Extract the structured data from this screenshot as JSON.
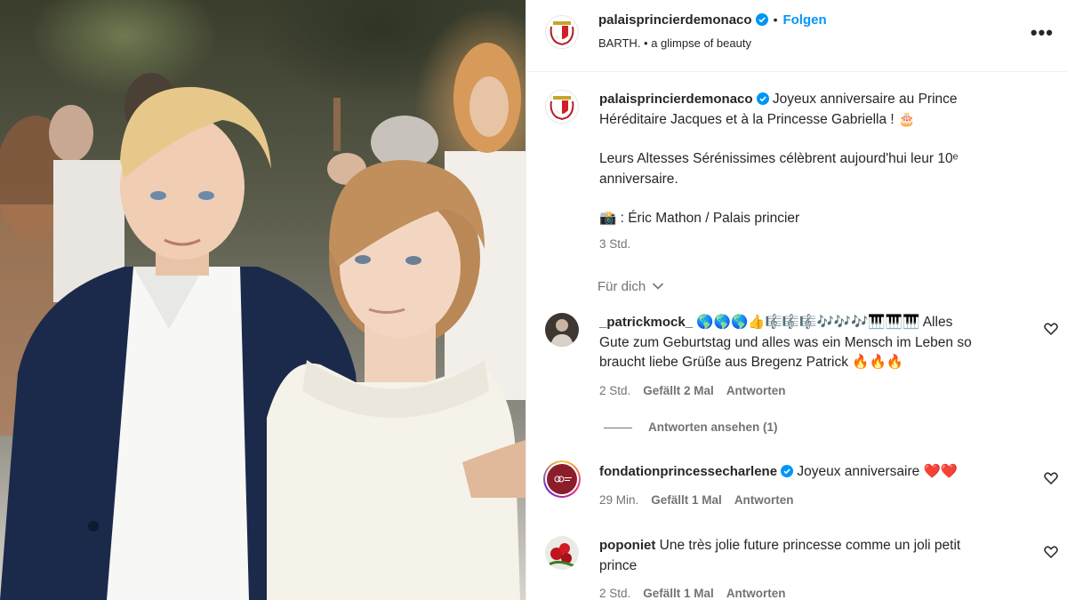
{
  "post": {
    "image_alt": "",
    "header": {
      "username": "palaisprincierdemonaco",
      "dot": "•",
      "follow_label": "Folgen",
      "subtitle": "BARTH. • a glimpse of beauty",
      "more_label": "•••"
    },
    "caption": {
      "username": "palaisprincierdemonaco",
      "text_line1": "Joyeux anniversaire au Prince",
      "text_line2": "Héréditaire Jacques et à la Princesse Gabriella ! 🎂",
      "text_line3": "Leurs Altesses Sérénissimes célèbrent aujourd'hui leur 10ᵉ",
      "text_line4": "anniversaire.",
      "credit": "📸 : Éric Mathon / Palais princier",
      "time": "3 Std."
    },
    "sort_label": "Für dich",
    "comments": [
      {
        "username": "_patrickmock_",
        "text_line1": "🌎🌎🌎👍🎼🎼🎼🎶🎶🎶🎹🎹🎹 Alles",
        "text_line2": "Gute zum Geburtstag und alles was ein Mensch im Leben so",
        "text_line3": "braucht liebe Grüße aus Bregenz Patrick 🔥🔥🔥",
        "time": "2 Std.",
        "likes": "Gefällt 2 Mal",
        "reply": "Antworten",
        "view_replies": "Antworten ansehen (1)"
      },
      {
        "username": "fondationprincessecharlene",
        "text_line1": "Joyeux anniversaire ❤️❤️",
        "time": "29 Min.",
        "likes": "Gefällt 1 Mal",
        "reply": "Antworten"
      },
      {
        "username": "poponiet",
        "text_line1": "Une très jolie future princesse comme un joli petit",
        "text_line2": "prince",
        "time": "2 Std.",
        "likes": "Gefällt 1 Mal",
        "reply": "Antworten"
      }
    ],
    "colors": {
      "accent": "#0095f6",
      "verified": "#0095f6",
      "muted": "#737373",
      "text": "#262626"
    }
  }
}
